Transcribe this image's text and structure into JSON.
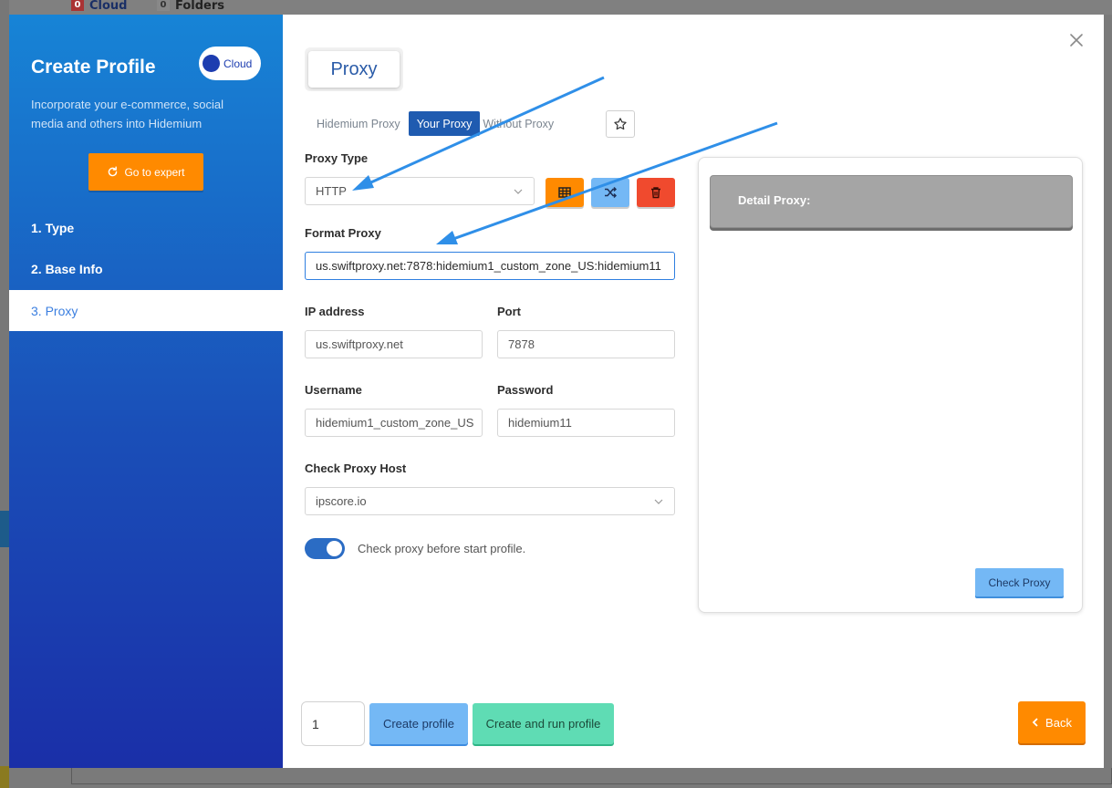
{
  "background": {
    "cloud_count": "0",
    "cloud_label": "Cloud",
    "folders_count": "0",
    "folders_label": "Folders"
  },
  "sidebar": {
    "title": "Create Profile",
    "cloud_toggle_label": "Cloud",
    "description": "Incorporate your e-commerce, social media and others into Hidemium",
    "expert_button": "Go to expert",
    "steps": [
      {
        "label": "1. Type"
      },
      {
        "label": "2. Base Info"
      },
      {
        "label": "3. Proxy"
      }
    ],
    "active_step": 2
  },
  "main": {
    "section_title": "Proxy",
    "tabs": [
      {
        "label": "Hidemium Proxy"
      },
      {
        "label": "Your Proxy"
      },
      {
        "label": "Without Proxy"
      }
    ],
    "active_tab": 1,
    "proxy_type": {
      "label": "Proxy Type",
      "value": "HTTP"
    },
    "format_proxy": {
      "label": "Format Proxy",
      "value": "us.swiftproxy.net:7878:hidemium1_custom_zone_US:hidemium11"
    },
    "ip_address": {
      "label": "IP address",
      "value": "us.swiftproxy.net"
    },
    "port": {
      "label": "Port",
      "value": "7878"
    },
    "username": {
      "label": "Username",
      "value": "hidemium1_custom_zone_US"
    },
    "password": {
      "label": "Password",
      "value": "hidemium11"
    },
    "check_host": {
      "label": "Check Proxy Host",
      "value": "ipscore.io"
    },
    "check_toggle": {
      "label": "Check proxy before start profile.",
      "on": true
    }
  },
  "detail": {
    "header": "Detail Proxy:",
    "check_button": "Check Proxy"
  },
  "footer": {
    "quantity": "1",
    "create_button": "Create profile",
    "create_run_button": "Create and run profile",
    "back_button": "Back"
  },
  "colors": {
    "accent_blue": "#1f5bb0",
    "orange": "#ff8a00",
    "red": "#f04a2e",
    "light_blue": "#74b8f5",
    "mint": "#5fdcb4",
    "annotation_arrow": "#2f8fe8"
  },
  "icons": {
    "expert": "refresh-icon",
    "table": "table-icon",
    "shuffle": "shuffle-icon",
    "delete": "trash-icon",
    "favorite": "star-icon",
    "close": "close-icon",
    "back": "chevron-left-icon"
  }
}
